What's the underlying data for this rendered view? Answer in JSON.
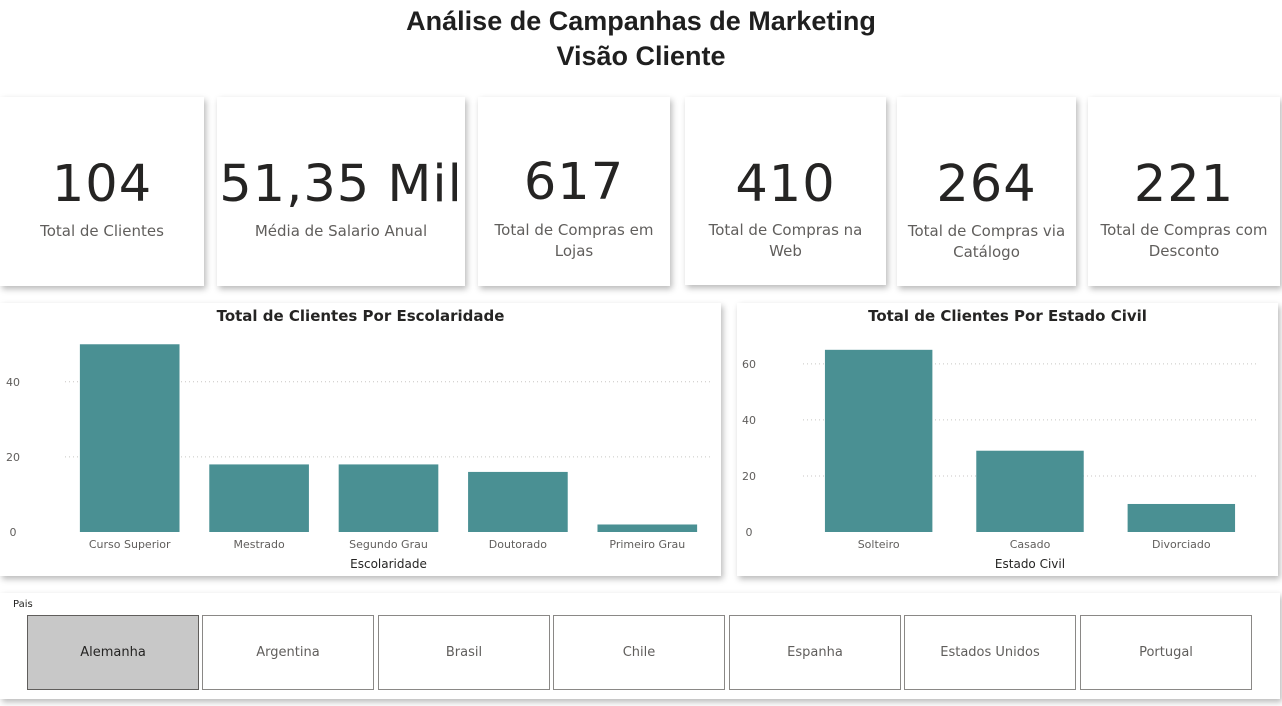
{
  "header": {
    "title_line1": "Análise de Campanhas de Marketing",
    "title_line2": "Visão Cliente"
  },
  "kpis": [
    {
      "value": "104",
      "label": "Total de Clientes"
    },
    {
      "value": "51,35 Mil",
      "label": "Média de Salario Anual"
    },
    {
      "value": "617",
      "label": "Total de Compras em Lojas"
    },
    {
      "value": "410",
      "label": "Total de Compras na Web"
    },
    {
      "value": "264",
      "label": "Total de Compras via Catálogo"
    },
    {
      "value": "221",
      "label": "Total de Compras com Desconto"
    }
  ],
  "colors": {
    "bar": "#4a9093",
    "grid": "#c8c6c4",
    "axis_text": "#605e5c"
  },
  "chart_data": [
    {
      "type": "bar",
      "title": "Total de Clientes Por Escolaridade",
      "xlabel": "Escolaridade",
      "ylabel": "",
      "categories": [
        "Curso Superior",
        "Mestrado",
        "Segundo Grau",
        "Doutorado",
        "Primeiro Grau"
      ],
      "values": [
        50,
        18,
        18,
        16,
        2
      ],
      "ylim": [
        0,
        53
      ],
      "yticks": [
        0,
        20,
        40
      ],
      "grid": true
    },
    {
      "type": "bar",
      "title": "Total de Clientes Por Estado Civil",
      "xlabel": "Estado Civil",
      "ylabel": "",
      "categories": [
        "Solteiro",
        "Casado",
        "Divorciado"
      ],
      "values": [
        65,
        29,
        10
      ],
      "ylim": [
        0,
        71
      ],
      "yticks": [
        0,
        20,
        40,
        60
      ],
      "grid": true
    }
  ],
  "slicer": {
    "label": "Pais",
    "items": [
      "Alemanha",
      "Argentina",
      "Brasil",
      "Chile",
      "Espanha",
      "Estados Unidos",
      "Portugal"
    ],
    "selected": "Alemanha"
  }
}
